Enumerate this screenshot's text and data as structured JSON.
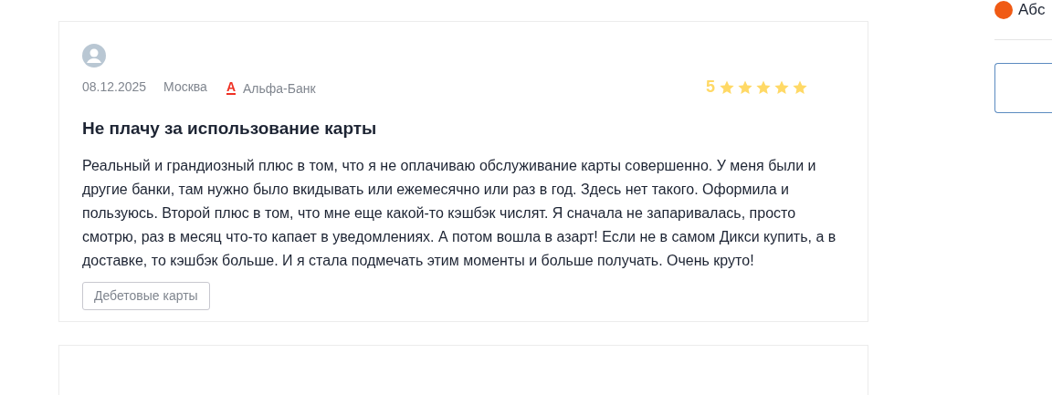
{
  "review": {
    "date": "08.12.2025",
    "city": "Москва",
    "bank": "Альфа-Банк",
    "bank_logo": "А",
    "rating": "5",
    "stars": 5,
    "title": "Не плачу за использование карты",
    "text": "Реальный и грандиозный плюс в том, что я не оплачиваю обслуживание карты совершенно. У меня были и другие банки, там нужно было вкидывать или ежемесячно или раз в год. Здесь нет такого. Оформила и пользуюсь. Второй плюс в том, что мне еще какой-то кэшбэк числят. Я сначала не запаривалась, просто смотрю, раз в месяц что-то капает в уведомлениях. А потом вошла в азарт! Если не в самом Дикси купить, а в доставке, то кэшбэк больше. И я стала подмечать этим моменты и больше получать. Очень круто!",
    "tag": "Дебетовые карты"
  },
  "sidebar": {
    "bank_name": "Абс"
  }
}
